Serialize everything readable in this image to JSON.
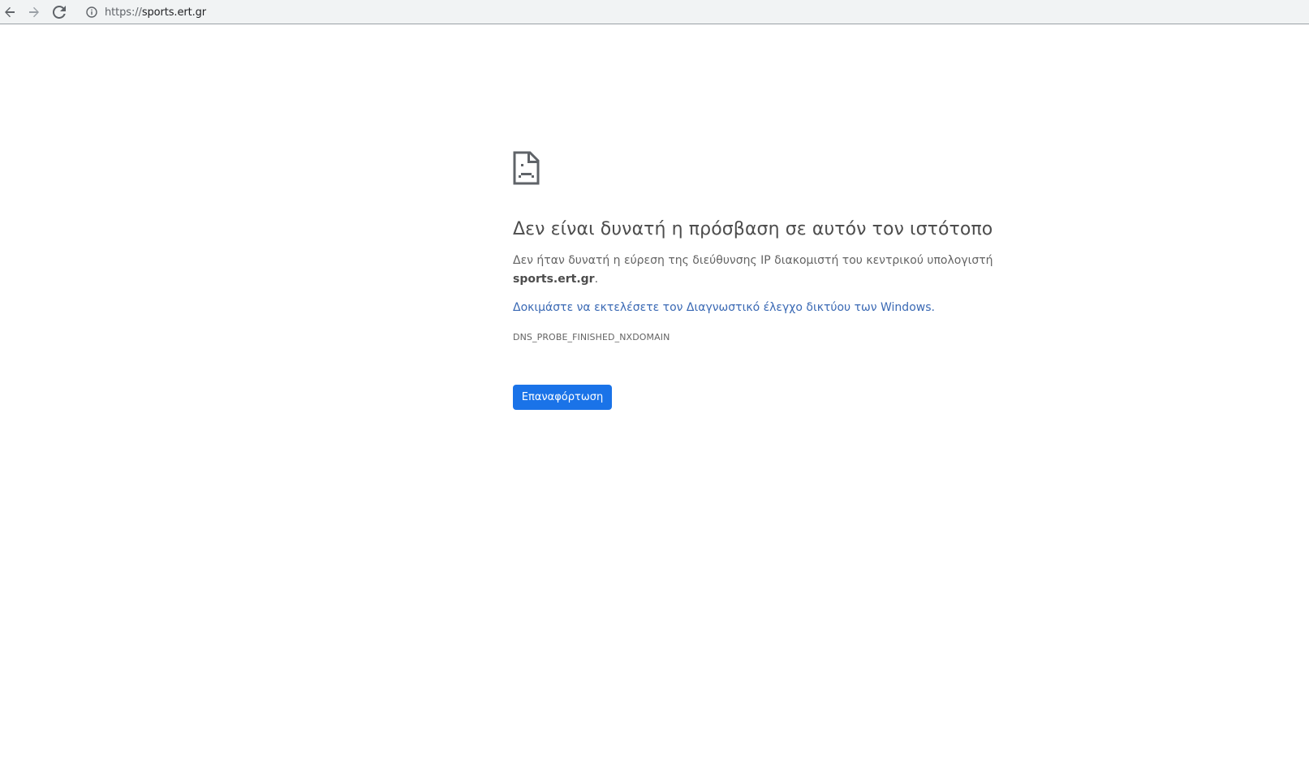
{
  "browser": {
    "back_icon": "arrow-left-icon",
    "forward_icon": "arrow-right-icon",
    "reload_icon": "reload-icon",
    "info_icon": "info-circle-icon",
    "url_scheme": "https://",
    "url_host": "sports.ert.gr"
  },
  "error_page": {
    "icon": "sad-document-icon",
    "title": "Δεν είναι δυνατή η πρόσβαση σε αυτόν τον ιστότοπο",
    "description_prefix": "Δεν ήταν δυνατή η εύρεση της διεύθυνσης IP διακομιστή του κεντρικού υπολογιστή",
    "description_host": "sports.ert.gr",
    "description_suffix": ".",
    "suggestion_link": "Δοκιμάστε να εκτελέσετε τον Διαγνωστικό έλεγχο δικτύου των Windows.",
    "error_code": "DNS_PROBE_FINISHED_NXDOMAIN",
    "reload_button": "Επαναφόρτωση"
  },
  "colors": {
    "toolbar_bg": "#f1f3f4",
    "title": "#4d4d4d",
    "link": "#3a69b4",
    "button": "#1a73e8"
  }
}
